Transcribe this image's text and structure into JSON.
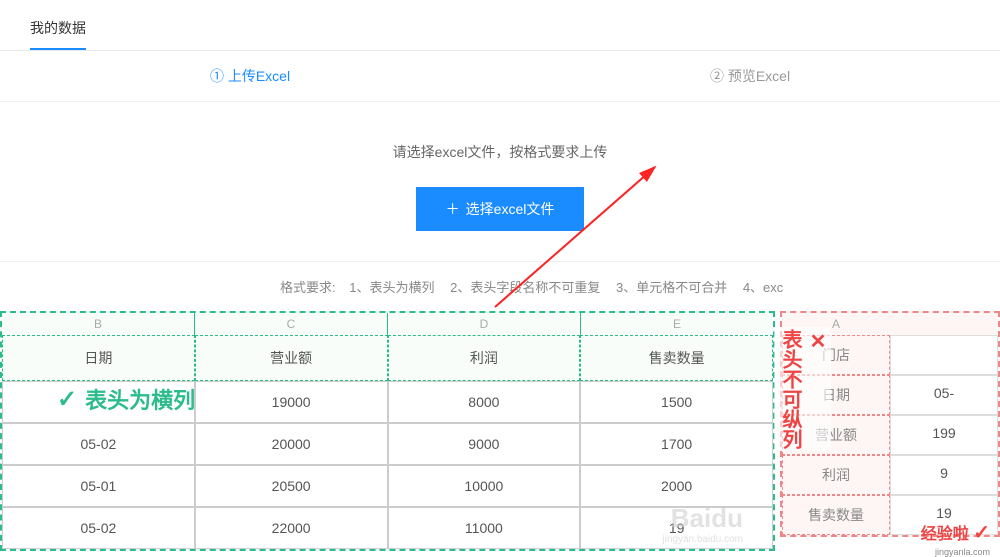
{
  "header": {
    "tab": "我的数据"
  },
  "steps": {
    "step1": {
      "num": "①",
      "label": "上传Excel"
    },
    "step2": {
      "num": "②",
      "label": "预览Excel"
    }
  },
  "upload": {
    "title": "请选择excel文件，按格式要求上传",
    "button": "选择excel文件",
    "plus": "＋"
  },
  "format": {
    "label": "格式要求:",
    "r1": "1、表头为横列",
    "r2": "2、表头字段名称不可重复",
    "r3": "3、单元格不可合并",
    "r4": "4、exc"
  },
  "good_table": {
    "col_letters": [
      "B",
      "C",
      "D",
      "E"
    ],
    "headers": [
      "日期",
      "营业额",
      "利润",
      "售卖数量"
    ],
    "rows": [
      [
        "",
        "19000",
        "8000",
        "1500"
      ],
      [
        "05-02",
        "20000",
        "9000",
        "1700"
      ],
      [
        "05-01",
        "20500",
        "10000",
        "2000"
      ],
      [
        "05-02",
        "22000",
        "11000",
        "19"
      ]
    ],
    "caption": "表头为横列",
    "check": "✓"
  },
  "bad_table": {
    "col_letters": [
      "A",
      ""
    ],
    "rows": [
      [
        "门店",
        ""
      ],
      [
        "日期",
        "05-"
      ],
      [
        "营业额",
        "199"
      ],
      [
        "利润",
        "9"
      ],
      [
        "售卖数量",
        "19"
      ]
    ],
    "caption": "表头不可纵列",
    "x": "✕"
  },
  "watermark": {
    "big": "Baidu",
    "small": "jingyan.baidu.com"
  },
  "jing": {
    "text": "经验啦",
    "check": "✓",
    "url": "jingyanla.com"
  }
}
